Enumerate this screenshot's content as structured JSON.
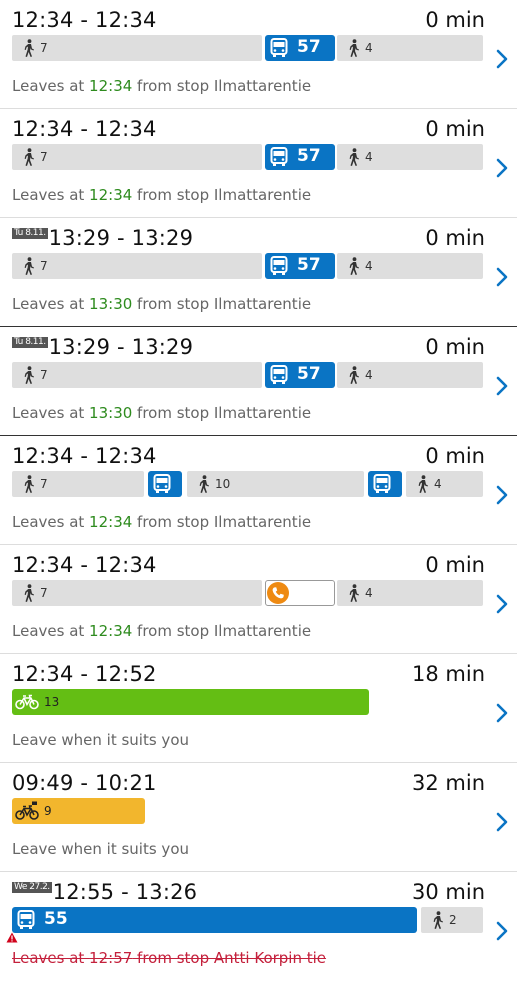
{
  "colors": {
    "walk_leg": "#dedede",
    "bus_leg": "#0a74c4",
    "citybike_leg": "#64be14",
    "own_bike_leg": "#f2b62d",
    "departure_time": "#2e8b1e",
    "cancelled": "#c4203c",
    "call_icon": "#ee8a12"
  },
  "itineraries": [
    {
      "date_badge": "",
      "time_range": "12:34 - 12:34",
      "duration": "0 min",
      "legs": [
        {
          "mode": "walk",
          "label": "7"
        },
        {
          "mode": "bus",
          "label": "57"
        },
        {
          "mode": "walk",
          "label": "4"
        }
      ],
      "info_prefix": "Leaves at ",
      "info_time": "12:34",
      "info_suffix": " from stop Ilmattarentie",
      "cancelled": false
    },
    {
      "date_badge": "",
      "time_range": "12:34 - 12:34",
      "duration": "0 min",
      "legs": [
        {
          "mode": "walk",
          "label": "7"
        },
        {
          "mode": "bus",
          "label": "57"
        },
        {
          "mode": "walk",
          "label": "4"
        }
      ],
      "info_prefix": "Leaves at ",
      "info_time": "12:34",
      "info_suffix": " from stop Ilmattarentie",
      "cancelled": false
    },
    {
      "date_badge": "Tu 8.11.",
      "time_range": "13:29 - 13:29",
      "duration": "0 min",
      "legs": [
        {
          "mode": "walk",
          "label": "7"
        },
        {
          "mode": "bus",
          "label": "57"
        },
        {
          "mode": "walk",
          "label": "4"
        }
      ],
      "info_prefix": "Leaves at ",
      "info_time": "13:30",
      "info_suffix": " from stop Ilmattarentie",
      "cancelled": false
    },
    {
      "date_badge": "Tu 8.11.",
      "time_range": "13:29 - 13:29",
      "duration": "0 min",
      "legs": [
        {
          "mode": "walk",
          "label": "7"
        },
        {
          "mode": "bus",
          "label": "57"
        },
        {
          "mode": "walk",
          "label": "4"
        }
      ],
      "info_prefix": "Leaves at ",
      "info_time": "13:30",
      "info_suffix": " from stop Ilmattarentie",
      "cancelled": false
    },
    {
      "date_badge": "",
      "time_range": "12:34 - 12:34",
      "duration": "0 min",
      "legs": [
        {
          "mode": "walk",
          "label": "7"
        },
        {
          "mode": "bus",
          "label": ""
        },
        {
          "mode": "walk",
          "label": "10"
        },
        {
          "mode": "bus",
          "label": ""
        },
        {
          "mode": "walk",
          "label": "4"
        }
      ],
      "info_prefix": "Leaves at ",
      "info_time": "12:34",
      "info_suffix": " from stop Ilmattarentie",
      "cancelled": false
    },
    {
      "date_badge": "",
      "time_range": "12:34 - 12:34",
      "duration": "0 min",
      "legs": [
        {
          "mode": "walk",
          "label": "7"
        },
        {
          "mode": "call",
          "label": ""
        },
        {
          "mode": "walk",
          "label": "4"
        }
      ],
      "info_prefix": "Leaves at ",
      "info_time": "12:34",
      "info_suffix": " from stop Ilmattarentie",
      "cancelled": false
    },
    {
      "date_badge": "",
      "time_range": "12:34 - 12:52",
      "duration": "18 min",
      "legs": [
        {
          "mode": "bike",
          "label": "13"
        }
      ],
      "info_prefix": "Leave when it suits you",
      "info_time": "",
      "info_suffix": "",
      "cancelled": false
    },
    {
      "date_badge": "",
      "time_range": "09:49 - 10:21",
      "duration": "32 min",
      "legs": [
        {
          "mode": "citybike",
          "label": "9"
        }
      ],
      "info_prefix": "Leave when it suits you",
      "info_time": "",
      "info_suffix": "",
      "cancelled": false
    },
    {
      "date_badge": "We 27.2.",
      "time_range": "12:55 - 13:26",
      "duration": "30 min",
      "legs": [
        {
          "mode": "bus",
          "label": "55"
        },
        {
          "mode": "walk",
          "label": "2"
        }
      ],
      "info_prefix": "Leaves at ",
      "info_time": "12:57",
      "info_suffix": " from stop Antti Korpin tie",
      "cancelled": true
    }
  ]
}
